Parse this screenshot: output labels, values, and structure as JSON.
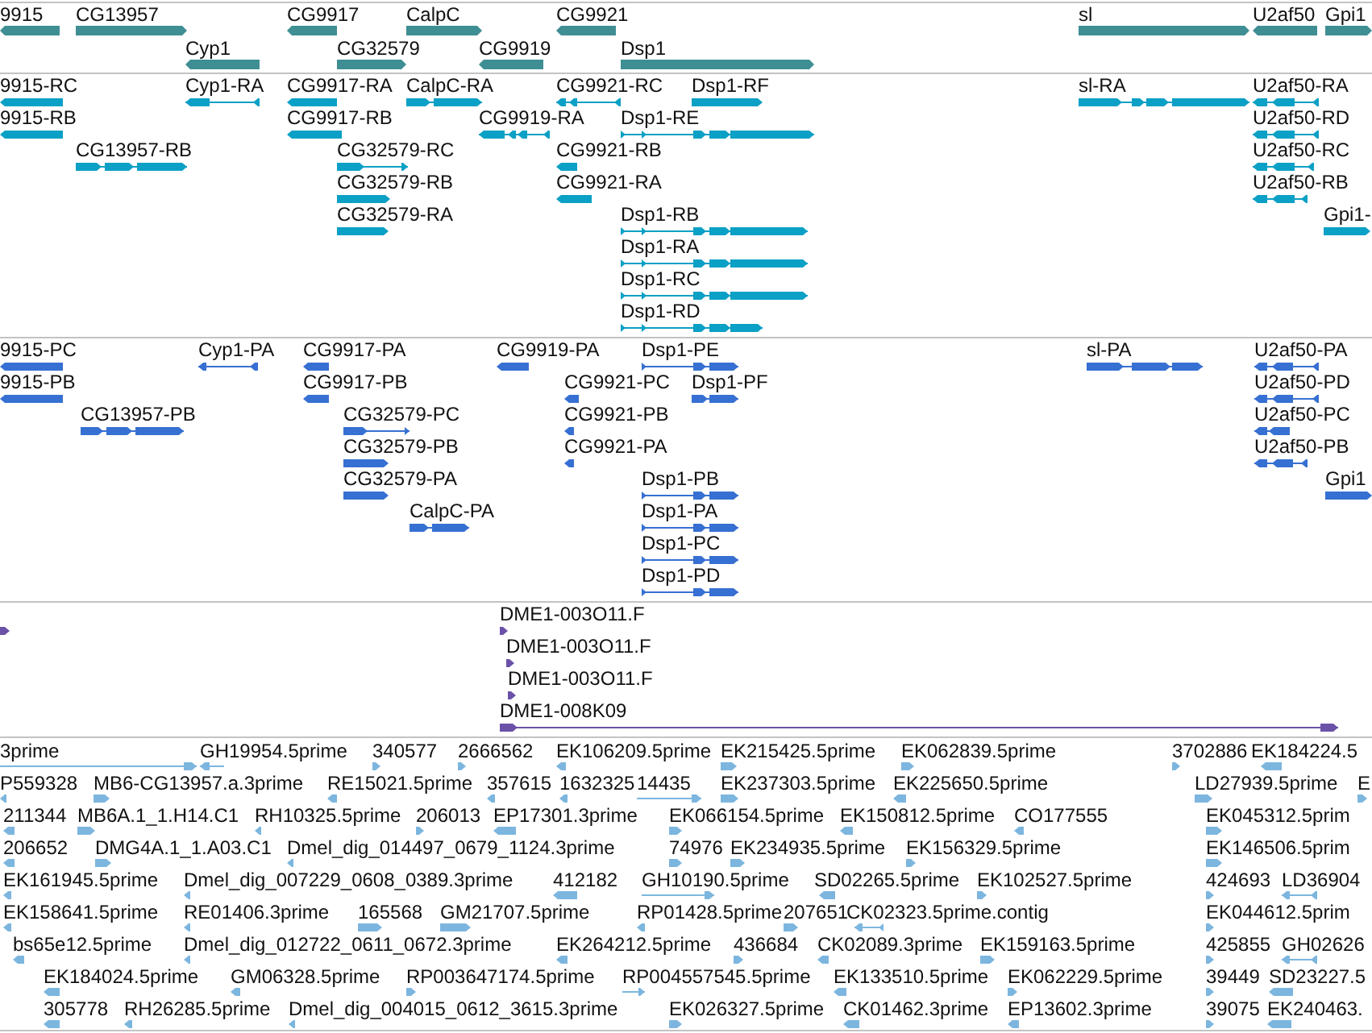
{
  "tracks": [
    {
      "kind": "gene",
      "lanes": [
        {
          "features": [
            {
              "label": "9915",
              "reverse": true
            },
            {
              "label": "CG13957",
              "reverse": false
            },
            {
              "label": "CG9917",
              "reverse": true
            },
            {
              "label": "CalpC",
              "reverse": false
            },
            {
              "label": "CG9921",
              "reverse": true
            },
            {
              "label": "sl",
              "reverse": false
            },
            {
              "label": "U2af50",
              "reverse": true
            },
            {
              "label": "Gpi1",
              "reverse": false
            }
          ]
        },
        {
          "features": [
            {
              "label": "Cyp1",
              "reverse": true
            },
            {
              "label": "CG32579",
              "reverse": false
            },
            {
              "label": "CG9919",
              "reverse": true
            },
            {
              "label": "Dsp1",
              "reverse": false
            }
          ]
        }
      ]
    },
    {
      "kind": "transcript",
      "lanes": [
        {
          "features": [
            {
              "label": "9915-RC",
              "reverse": true
            },
            {
              "label": "Cyp1-RA",
              "reverse": true
            },
            {
              "label": "CG9917-RA",
              "reverse": true
            },
            {
              "label": "CalpC-RA",
              "reverse": false
            },
            {
              "label": "CG9921-RC",
              "reverse": true
            },
            {
              "label": "Dsp1-RF",
              "reverse": false
            },
            {
              "label": "sl-RA",
              "reverse": false
            },
            {
              "label": "U2af50-RA",
              "reverse": true
            }
          ]
        },
        {
          "features": [
            {
              "label": "9915-RB",
              "reverse": true
            },
            {
              "label": "CG9917-RB",
              "reverse": true
            },
            {
              "label": "CG9919-RA",
              "reverse": true
            },
            {
              "label": "Dsp1-RE",
              "reverse": false
            },
            {
              "label": "U2af50-RD",
              "reverse": true
            }
          ]
        },
        {
          "features": [
            {
              "label": "CG13957-RB",
              "reverse": false
            },
            {
              "label": "CG32579-RC",
              "reverse": false
            },
            {
              "label": "CG9921-RB",
              "reverse": true
            },
            {
              "label": "U2af50-RC",
              "reverse": true
            }
          ]
        },
        {
          "features": [
            {
              "label": "CG32579-RB",
              "reverse": false
            },
            {
              "label": "CG9921-RA",
              "reverse": true
            },
            {
              "label": "U2af50-RB",
              "reverse": true
            }
          ]
        },
        {
          "features": [
            {
              "label": "CG32579-RA",
              "reverse": false
            },
            {
              "label": "Dsp1-RB",
              "reverse": false
            },
            {
              "label": "Gpi1-",
              "reverse": false
            }
          ]
        },
        {
          "features": [
            {
              "label": "Dsp1-RA",
              "reverse": false
            }
          ]
        },
        {
          "features": [
            {
              "label": "Dsp1-RC",
              "reverse": false
            }
          ]
        },
        {
          "features": [
            {
              "label": "Dsp1-RD",
              "reverse": false
            }
          ]
        }
      ]
    },
    {
      "kind": "protein",
      "lanes": [
        {
          "features": [
            {
              "label": "9915-PC",
              "reverse": true
            },
            {
              "label": "Cyp1-PA",
              "reverse": true
            },
            {
              "label": "CG9917-PA",
              "reverse": true
            },
            {
              "label": "CG9919-PA",
              "reverse": true
            },
            {
              "label": "Dsp1-PE",
              "reverse": false
            },
            {
              "label": "sl-PA",
              "reverse": false
            },
            {
              "label": "U2af50-PA",
              "reverse": true
            }
          ]
        },
        {
          "features": [
            {
              "label": "9915-PB",
              "reverse": true
            },
            {
              "label": "CG9917-PB",
              "reverse": true
            },
            {
              "label": "CG9921-PC",
              "reverse": true
            },
            {
              "label": "Dsp1-PF",
              "reverse": false
            },
            {
              "label": "U2af50-PD",
              "reverse": true
            }
          ]
        },
        {
          "features": [
            {
              "label": "CG13957-PB",
              "reverse": false
            },
            {
              "label": "CG32579-PC",
              "reverse": false
            },
            {
              "label": "CG9921-PB",
              "reverse": true
            },
            {
              "label": "U2af50-PC",
              "reverse": true
            }
          ]
        },
        {
          "features": [
            {
              "label": "CG32579-PB",
              "reverse": false
            },
            {
              "label": "CG9921-PA",
              "reverse": true
            },
            {
              "label": "U2af50-PB",
              "reverse": true
            }
          ]
        },
        {
          "features": [
            {
              "label": "CG32579-PA",
              "reverse": false
            },
            {
              "label": "Dsp1-PB",
              "reverse": false
            },
            {
              "label": "Gpi1",
              "reverse": false
            }
          ]
        },
        {
          "features": [
            {
              "label": "CalpC-PA",
              "reverse": false
            },
            {
              "label": "Dsp1-PA",
              "reverse": false
            }
          ]
        },
        {
          "features": [
            {
              "label": "Dsp1-PC",
              "reverse": false
            }
          ]
        },
        {
          "features": [
            {
              "label": "Dsp1-PD",
              "reverse": false
            }
          ]
        }
      ]
    },
    {
      "kind": "clone",
      "lanes": [
        {
          "features": [
            {
              "reverse": false
            },
            {
              "label": "DME1-003O11.F",
              "reverse": false
            }
          ]
        },
        {
          "features": [
            {
              "label": "DME1-003O11.F",
              "reverse": false
            }
          ]
        },
        {
          "features": [
            {
              "label": "DME1-003O11.F",
              "reverse": false
            }
          ]
        },
        {
          "features": [
            {
              "label": "DME1-008K09",
              "reverse": false
            }
          ]
        }
      ]
    },
    {
      "kind": "est",
      "lanes": [
        {
          "features": [
            {
              "label": "3prime",
              "reverse": false
            },
            {
              "label": "GH19954.5prime",
              "reverse": true
            },
            {
              "label": "340577",
              "reverse": false
            },
            {
              "label": "2666562",
              "reverse": false
            },
            {
              "label": "EK106209.5prime",
              "reverse": true
            },
            {
              "label": "EK215425.5prime",
              "reverse": false
            },
            {
              "label": "EK062839.5prime",
              "reverse": false
            },
            {
              "label": "3702886",
              "reverse": false
            },
            {
              "label": "EK184224.5",
              "reverse": true
            }
          ]
        },
        {
          "features": [
            {
              "label": "P559328",
              "reverse": true
            },
            {
              "label": "MB6-CG13957.a.3prime",
              "reverse": false
            },
            {
              "label": "RE15021.5prime",
              "reverse": true
            },
            {
              "label": "357615",
              "reverse": true
            },
            {
              "label": "1632325",
              "reverse": true
            },
            {
              "label": "14435",
              "reverse": false
            },
            {
              "label": "EK237303.5prime",
              "reverse": false
            },
            {
              "label": "EK225650.5prime",
              "reverse": true
            },
            {
              "label": "LD27939.5prime",
              "reverse": false
            },
            {
              "label": "E",
              "reverse": false
            }
          ]
        },
        {
          "features": [
            {
              "label": "211344",
              "reverse": true
            },
            {
              "label": "MB6A.1_1.H14.C1",
              "reverse": false
            },
            {
              "label": "RH10325.5prime",
              "reverse": true
            },
            {
              "label": "206013",
              "reverse": false
            },
            {
              "label": "EP17301.3prime",
              "reverse": true
            },
            {
              "label": "EK066154.5prime",
              "reverse": false
            },
            {
              "label": "EK150812.5prime",
              "reverse": true
            },
            {
              "label": "CO177555",
              "reverse": true
            },
            {
              "label": "EK045312.5prim",
              "reverse": false
            }
          ]
        },
        {
          "features": [
            {
              "label": "206652",
              "reverse": true
            },
            {
              "label": "DMG4A.1_1.A03.C1",
              "reverse": false
            },
            {
              "label": "Dmel_dig_014497_0679_1124.3prime",
              "reverse": true
            },
            {
              "label": "74976",
              "reverse": false
            },
            {
              "label": "EK234935.5prime",
              "reverse": false
            },
            {
              "label": "EK156329.5prime",
              "reverse": false
            },
            {
              "label": "EK146506.5prim",
              "reverse": false
            }
          ]
        },
        {
          "features": [
            {
              "label": "EK161945.5prime",
              "reverse": true
            },
            {
              "label": "Dmel_dig_007229_0608_0389.3prime",
              "reverse": true
            },
            {
              "label": "412182",
              "reverse": true
            },
            {
              "label": "GH10190.5prime",
              "reverse": false
            },
            {
              "label": "SD02265.5prime",
              "reverse": true
            },
            {
              "label": "EK102527.5prime",
              "reverse": false
            },
            {
              "label": "424693",
              "reverse": false
            },
            {
              "label": "LD36904",
              "reverse": true
            }
          ]
        },
        {
          "features": [
            {
              "label": "EK158641.5prime",
              "reverse": true
            },
            {
              "label": "RE01406.3prime",
              "reverse": true
            },
            {
              "label": "165568",
              "reverse": false
            },
            {
              "label": "GM21707.5prime",
              "reverse": false
            },
            {
              "label": "RP01428.5prime",
              "reverse": true
            },
            {
              "label": "207651",
              "reverse": false
            },
            {
              "label": "CK02323.5prime.contig",
              "reverse": true
            },
            {
              "label": "EK044612.5prim",
              "reverse": false
            }
          ]
        },
        {
          "features": [
            {
              "label": "bs65e12.5prime",
              "reverse": true
            },
            {
              "label": "Dmel_dig_012722_0611_0672.3prime",
              "reverse": true
            },
            {
              "label": "EK264212.5prime",
              "reverse": true
            },
            {
              "label": "436684",
              "reverse": false
            },
            {
              "label": "CK02089.3prime",
              "reverse": true
            },
            {
              "label": "EK159163.5prime",
              "reverse": false
            },
            {
              "label": "425855",
              "reverse": false
            },
            {
              "label": "GH02626",
              "reverse": true
            }
          ]
        },
        {
          "features": [
            {
              "label": "EK184024.5prime",
              "reverse": true
            },
            {
              "label": "GM06328.5prime",
              "reverse": true
            },
            {
              "label": "RP003647174.5prime",
              "reverse": false
            },
            {
              "label": "RP004557545.5prime",
              "reverse": false
            },
            {
              "label": "EK133510.5prime",
              "reverse": true
            },
            {
              "label": "EK062229.5prime",
              "reverse": false
            },
            {
              "label": "39449",
              "reverse": false
            },
            {
              "label": "SD23227.5",
              "reverse": true
            }
          ]
        },
        {
          "features": [
            {
              "label": "305778",
              "reverse": true
            },
            {
              "label": "RH26285.5prime",
              "reverse": true
            },
            {
              "label": "Dmel_dig_004015_0612_3615.3prime",
              "reverse": true
            },
            {
              "label": "EK026327.5prime",
              "reverse": false
            },
            {
              "label": "CK01462.3prime",
              "reverse": true
            },
            {
              "label": "EP13602.3prime",
              "reverse": true
            },
            {
              "label": "39075",
              "reverse": false
            },
            {
              "label": "EK240463.",
              "reverse": true
            }
          ]
        }
      ]
    }
  ]
}
